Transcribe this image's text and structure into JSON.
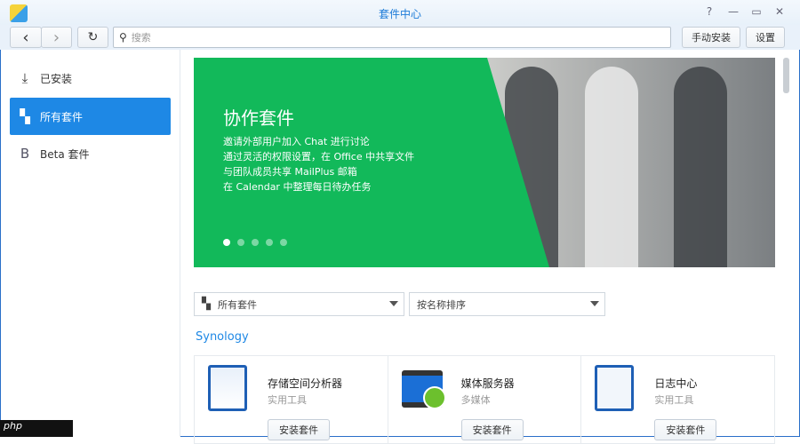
{
  "window": {
    "title": "套件中心",
    "help": "?",
    "minimize": "—",
    "maximize": "▭",
    "close": "✕"
  },
  "toolbar": {
    "back": "‹",
    "forward": "›",
    "refresh": "↻",
    "search_placeholder": "搜索",
    "manual_install": "手动安装",
    "settings": "设置"
  },
  "sidebar": {
    "items": [
      {
        "label": "已安装",
        "icon": "download-icon"
      },
      {
        "label": "所有套件",
        "icon": "grid-icon",
        "selected": true
      },
      {
        "label": "Beta 套件",
        "icon": "beta-icon"
      }
    ]
  },
  "banner": {
    "title": "协作套件",
    "lines": [
      "邀请外部用户加入 Chat 进行讨论",
      "通过灵活的权限设置，在 Office 中共享文件",
      "与团队成员共享 MailPlus 邮箱",
      "在 Calendar 中整理每日待办任务"
    ],
    "slides": 5,
    "active_slide": 1
  },
  "filters": {
    "category": "所有套件",
    "sort": "按名称排序"
  },
  "section": "Synology",
  "packages": [
    {
      "name": "存储空间分析器",
      "category": "实用工具",
      "button": "安装套件"
    },
    {
      "name": "媒体服务器",
      "category": "多媒体",
      "button": "安装套件"
    },
    {
      "name": "日志中心",
      "category": "实用工具",
      "button": "安装套件"
    }
  ],
  "watermark": "php"
}
